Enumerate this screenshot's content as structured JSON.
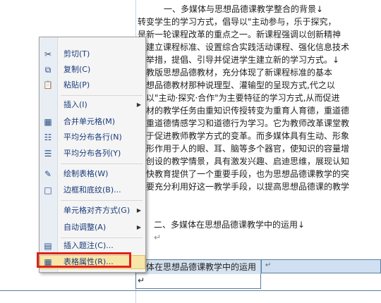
{
  "document": {
    "lines": [
      "一、多媒体与思想品德课教学整合的背景↓",
      "转变学生的学习方式，倡导以\"主动参与，乐于探究，",
      "是新一轮课程改革的重点之一。新课程强调以创新精神",
      "过建立课程标准、设置综合实践活动课程、强化信息技术",
      "列举措，提倡、引导并促进学生建立新的学习方式。↓",
      "鲁教版思想品德教材，充分体现了新课程标准的基本",
      "思想品德教材那种说理型、灌输型的呈现方式,代之以",
      "为以\"主动·探究·合作\"为主要特征的学习方式,从而促进",
      "数材的教学任务由重知识传授转变为重育人育德，重道德",
      "向重道德情感学习和道德行为学习。它为教师改革课堂教",
      "用于促进教师教学方式的变革。而多媒体具有生动、形象",
      "，形作用于人的眼、耳、脑等多个器官，使知识的容量增",
      "所创设的教学情景，具有激发兴趣、启迪思维，展现认知",
      "愉快教育提供了一个重要手段，也为思想品德课教学的突",
      "们要充分利用好这一教学手段，以提高思想品德课的教学",
      "二、多媒体在思想品德课教学中的运用↓",
      "↵"
    ],
    "table_cell_text": "媒体在思想品德课教学中的运用↵",
    "table_cell2_mark": "↵"
  },
  "context_menu": {
    "items": [
      {
        "label": "剪切(T)",
        "icon": "scissors-icon",
        "glyph": "✂",
        "submenu": false
      },
      {
        "label": "复制(C)",
        "icon": "copy-icon",
        "glyph": "⧉",
        "submenu": false
      },
      {
        "label": "粘贴(P)",
        "icon": "paste-icon",
        "glyph": "📋",
        "submenu": false
      },
      {
        "label": "插入(I)",
        "icon": "",
        "glyph": "",
        "submenu": true
      },
      {
        "label": "合并单元格(M)",
        "icon": "merge-cells-icon",
        "glyph": "▦",
        "submenu": false
      },
      {
        "label": "平均分布各行(N)",
        "icon": "distribute-rows-icon",
        "glyph": "☷",
        "submenu": false
      },
      {
        "label": "平均分布各列(Y)",
        "icon": "distribute-columns-icon",
        "glyph": "☰",
        "submenu": false
      },
      {
        "label": "绘制表格(W)",
        "icon": "draw-table-icon",
        "glyph": "✎",
        "submenu": false
      },
      {
        "label": "边框和底纹(B)...",
        "icon": "borders-shading-icon",
        "glyph": "□",
        "submenu": false
      },
      {
        "label": "单元格对齐方式(G)",
        "icon": "",
        "glyph": "",
        "submenu": true
      },
      {
        "label": "自动调整(A)",
        "icon": "",
        "glyph": "",
        "submenu": true
      },
      {
        "label": "插入题注(C)...",
        "icon": "insert-caption-icon",
        "glyph": "▤",
        "submenu": false
      },
      {
        "label": "表格属性(R)...",
        "icon": "table-properties-icon",
        "glyph": "▦",
        "submenu": false
      }
    ],
    "submenu_arrow": "▶"
  },
  "colors": {
    "highlight_box": "#e0201b",
    "menu_text": "#1a3b7a",
    "hover_fill": "#f8e6a9"
  }
}
